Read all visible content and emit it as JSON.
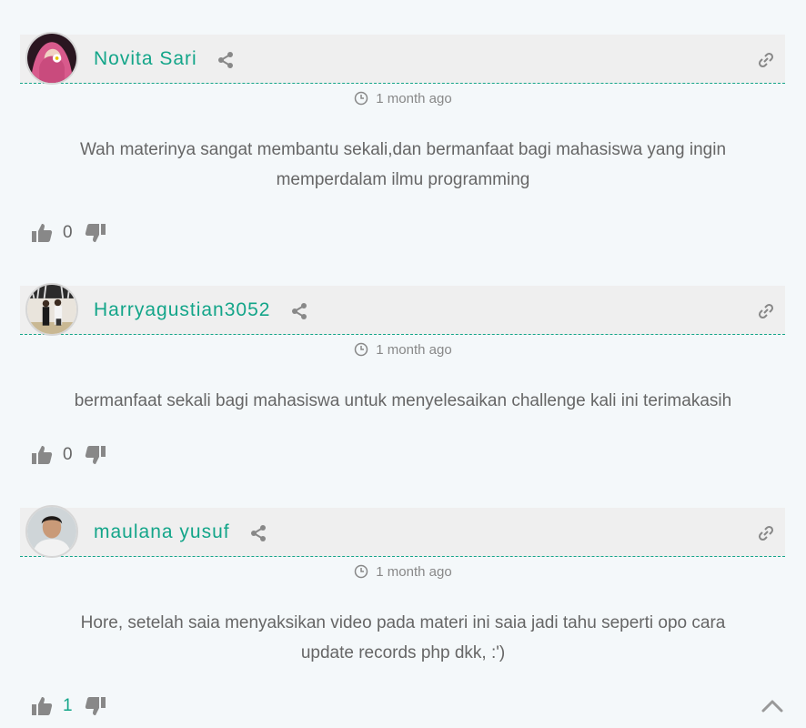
{
  "icons": {
    "share": "share-icon",
    "link": "link-icon",
    "clock": "clock-icon",
    "upvote": "thumbs-up-icon",
    "downvote": "thumbs-down-icon",
    "scroll_top": "chevron-up-icon"
  },
  "colors": {
    "accent": "#13a589",
    "header_bg": "#efefef",
    "page_bg": "#f4f8fa",
    "text": "#666666",
    "icon_gray": "#888888"
  },
  "comments": [
    {
      "author": "Novita Sari",
      "time": "1 month ago",
      "text_lines": [
        "Wah materinya sangat membantu sekali,dan bermanfaat bagi mahasiswa yang ingin",
        "memperdalam ilmu programming"
      ],
      "votes": "0"
    },
    {
      "author": "Harryagustian3052",
      "time": "1 month ago",
      "text_lines": [
        "bermanfaat sekali bagi mahasiswa untuk menyelesaikan challenge kali ini terimakasih"
      ],
      "votes": "0"
    },
    {
      "author": "maulana yusuf",
      "time": "1 month ago",
      "text_lines": [
        "Hore, setelah saia menyaksikan video pada materi ini saia jadi tahu seperti opo cara",
        "update records php dkk, :')"
      ],
      "votes": "1"
    }
  ]
}
